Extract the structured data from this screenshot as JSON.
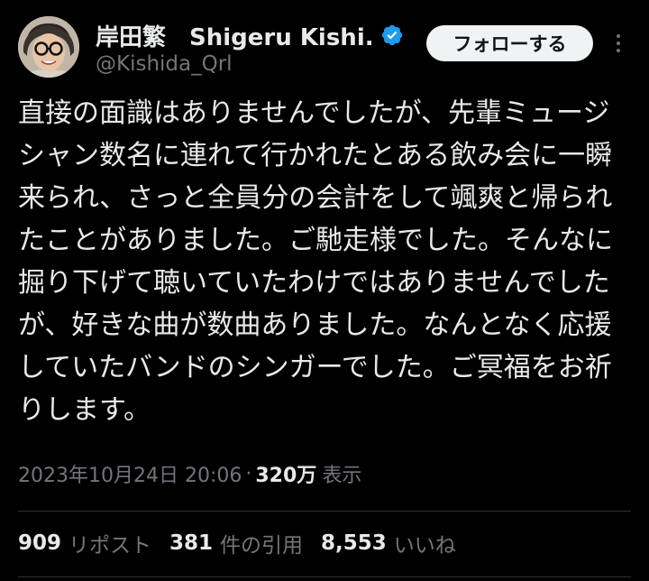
{
  "author": {
    "display_name": "岸田繁　Shigeru Kishi...",
    "handle": "@Kishida_Qrl",
    "verified_color": "#1d9bf0"
  },
  "header": {
    "follow_label": "フォローする",
    "more_icon": "more-horizontal-icon"
  },
  "tweet": {
    "text": "直接の面識はありませんでしたが、先輩ミュージシャン数名に連れて行かれたとある飲み会に一瞬来られ、さっと全員分の会計をして颯爽と帰られたことがありました。ご馳走様でした。そんなに掘り下げて聴いていたわけではありませんでしたが、好きな曲が数曲ありました。なんとなく応援していたバンドのシンガーでした。ご冥福をお祈りします。"
  },
  "meta": {
    "timestamp": "2023年10月24日 20:06",
    "separator": "·",
    "views": "320万",
    "views_label": "表示"
  },
  "stats": [
    {
      "num": "909",
      "label": "リポスト"
    },
    {
      "num": "381",
      "label": "件の引用"
    },
    {
      "num": "8,553",
      "label": "いいね"
    }
  ],
  "colors": {
    "background": "#000000",
    "text_primary": "#e7e9ea",
    "text_secondary": "#71767b",
    "divider": "#2f3336",
    "follow_bg": "#eff3f4"
  }
}
